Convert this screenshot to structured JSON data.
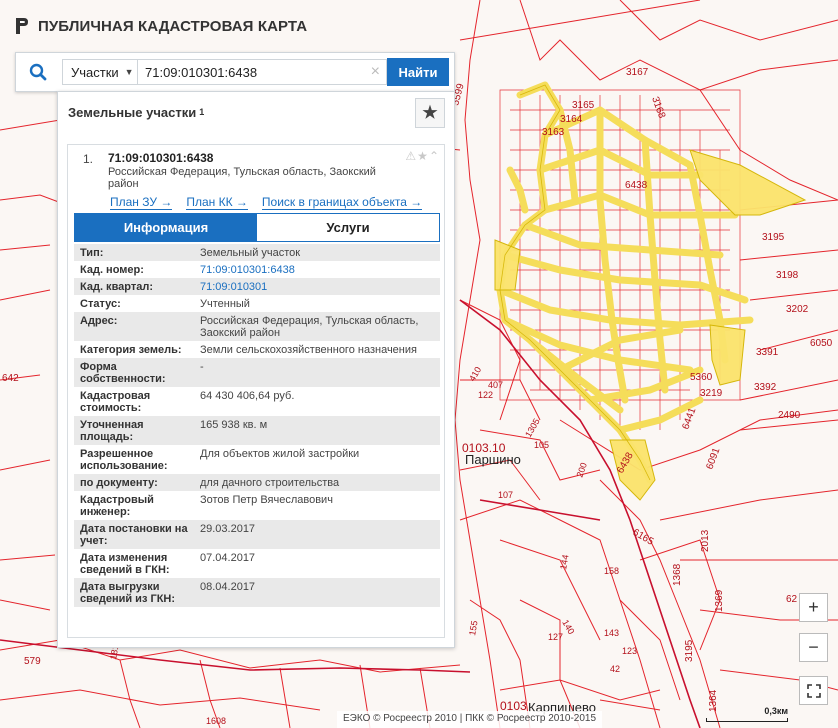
{
  "app": {
    "title": "ПУБЛИЧНАЯ КАДАСТРОВАЯ КАРТА"
  },
  "search": {
    "type_label": "Участки",
    "query": "71:09:010301:6438",
    "button_label": "Найти"
  },
  "results": {
    "header": "Земельные участки",
    "count": "1",
    "item": {
      "number": "1.",
      "title": "71:09:010301:6438",
      "address": "Российская Федерация, Тульская область, Заокский район",
      "links": [
        "План ЗУ →",
        "План КК →",
        "Поиск в границах объекта →"
      ],
      "tabs": [
        "Информация",
        "Услуги"
      ],
      "fields": [
        {
          "k": "Тип:",
          "v": "Земельный участок"
        },
        {
          "k": "Кад. номер:",
          "v": "71:09:010301:6438",
          "link": true
        },
        {
          "k": "Кад. квартал:",
          "v": "71:09:010301",
          "link": true
        },
        {
          "k": "Статус:",
          "v": "Учтенный"
        },
        {
          "k": "Адрес:",
          "v": "Российская Федерация, Тульская область, Заокский район"
        },
        {
          "k": "Категория земель:",
          "v": "Земли сельскохозяйственного назначения"
        },
        {
          "k": "Форма собственности:",
          "v": "-"
        },
        {
          "k": "Кадастровая стоимость:",
          "v": "64 430 406,64 руб."
        },
        {
          "k": "Уточненная площадь:",
          "v": "165 938 кв. м"
        },
        {
          "k": "Разрешенное использование:",
          "v": "Для объектов жилой застройки"
        },
        {
          "k": "по документу:",
          "v": "для дачного строительства"
        },
        {
          "k": "Кадастровый инженер:",
          "v": "Зотов Петр Вячеславович"
        },
        {
          "k": "Дата постановки на учет:",
          "v": "29.03.2017"
        },
        {
          "k": "Дата изменения сведений в ГКН:",
          "v": "07.04.2017"
        },
        {
          "k": "Дата выгрузки сведений из ГКН:",
          "v": "08.04.2017"
        }
      ]
    }
  },
  "map": {
    "labels": [
      "3167",
      "3168",
      "3165",
      "3164",
      "3163",
      "6438",
      "3195",
      "3198",
      "3202",
      "6050",
      "3391",
      "3392",
      "2490",
      "5360",
      "3219",
      "6441",
      "6091",
      "5599",
      "642",
      "0103.10",
      "Паршино",
      "6438",
      "6165",
      "2013",
      "1368",
      "1369",
      "3195",
      "579",
      "1364",
      "0103",
      "Карпишево",
      "62"
    ],
    "parcel_ids": [
      "410",
      "407",
      "122",
      "105",
      "107",
      "1305",
      "200",
      "158",
      "144",
      "143",
      "123",
      "42",
      "140",
      "127",
      "155",
      "181",
      "1608"
    ],
    "colors": {
      "boundary": "#e0000a",
      "highlight_fill": "#fbe46c",
      "highlight_stroke": "#d4b400",
      "background": "#fbf7f4"
    }
  },
  "controls": {
    "zoom_in": "+",
    "zoom_out": "−"
  },
  "attribution": "ЕЭКО © Росреестр 2010 | ПКК © Росреестр 2010-2015",
  "scale": {
    "label": "0,3км"
  }
}
